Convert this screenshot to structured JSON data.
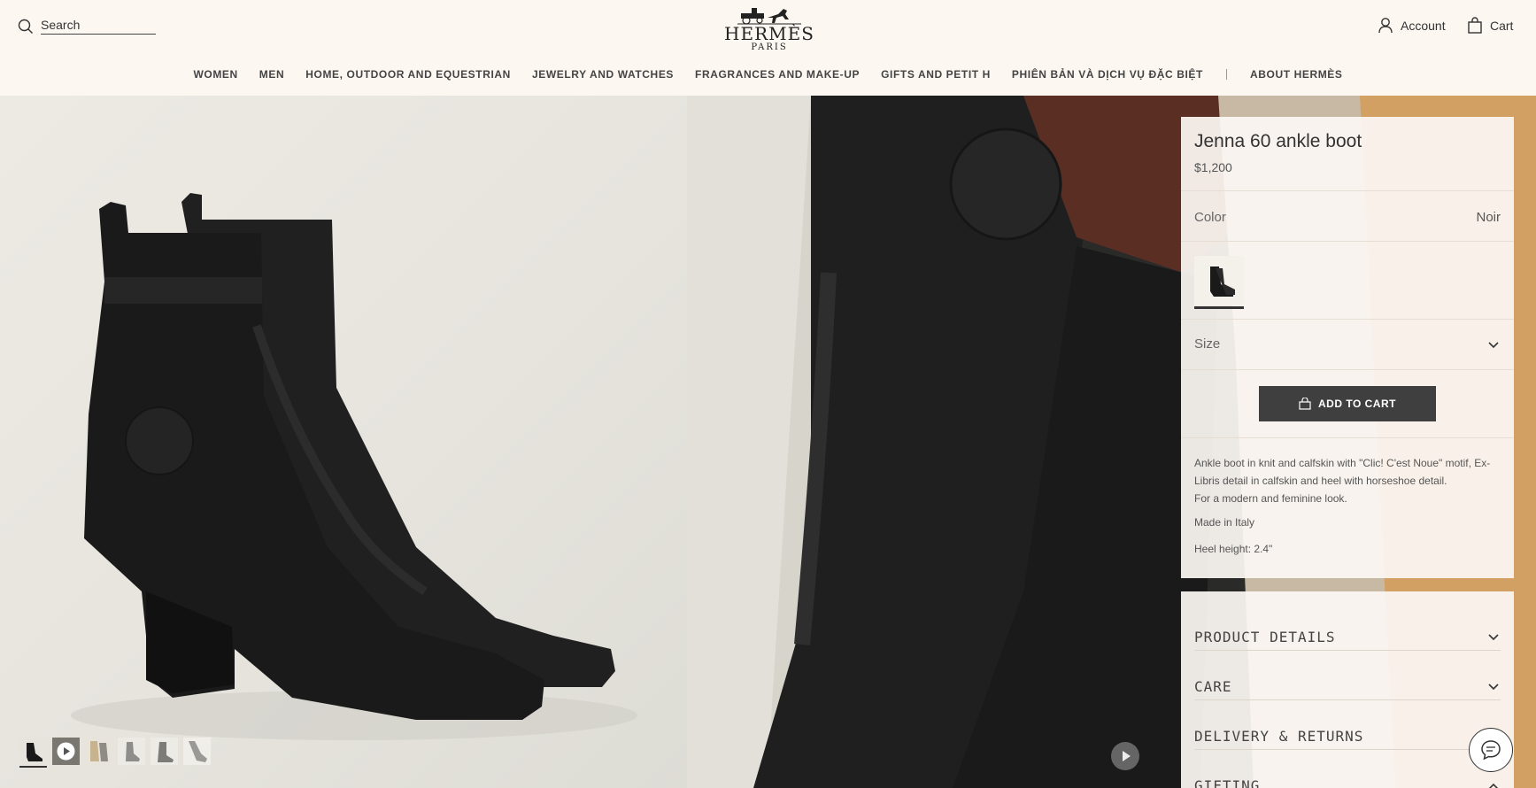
{
  "header": {
    "search_label": "Search",
    "brand": "HERMÈS",
    "city": "PARIS",
    "account_label": "Account",
    "cart_label": "Cart"
  },
  "nav": {
    "items": [
      "WOMEN",
      "MEN",
      "HOME, OUTDOOR AND EQUESTRIAN",
      "JEWELRY AND WATCHES",
      "FRAGRANCES AND MAKE-UP",
      "GIFTS AND PETIT H",
      "PHIÊN BẢN VÀ DỊCH VỤ ĐẶC BIỆT"
    ],
    "about": "ABOUT HERMÈS"
  },
  "product": {
    "title": "Jenna 60 ankle boot",
    "price": "$1,200",
    "color_label": "Color",
    "color_value": "Noir",
    "size_label": "Size",
    "add_to_cart": "ADD TO CART",
    "description": "Ankle boot in knit and calfskin with \"Clic! C'est Noue\" motif, Ex-Libris detail in calfskin and heel with horseshoe detail.",
    "description_2": "For a modern and feminine look.",
    "made_in": "Made in Italy",
    "heel_height": "Heel height: 2.4\""
  },
  "accordion": {
    "items": [
      "PRODUCT DETAILS",
      "CARE",
      "DELIVERY & RETURNS",
      "GIFTING"
    ]
  },
  "colors": {
    "background": "#fcf7f1",
    "button": "#3f3f3f",
    "panel": "#fcf8f3"
  },
  "icons": [
    "search-icon",
    "account-icon",
    "cart-icon",
    "chevron-down-icon",
    "chevron-up-icon",
    "play-icon",
    "chat-icon",
    "bag-icon"
  ]
}
